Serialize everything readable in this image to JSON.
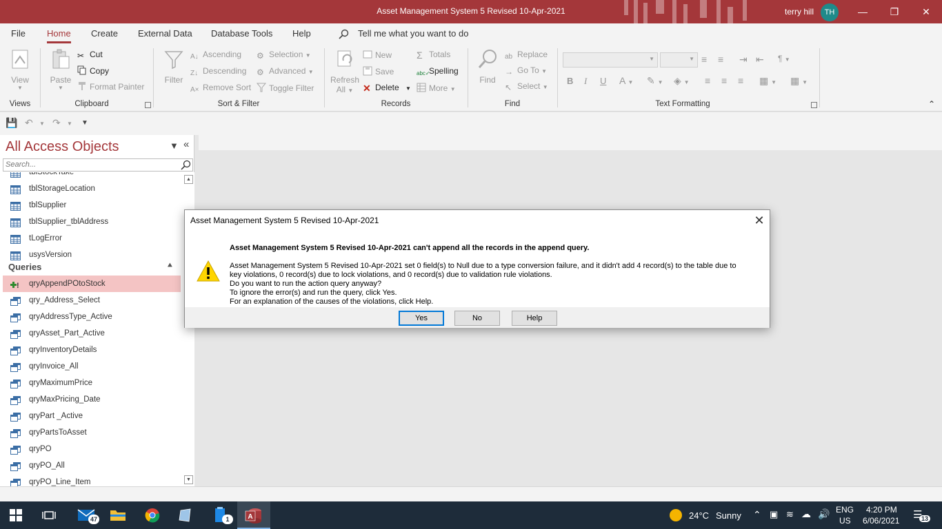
{
  "window": {
    "title": "Asset Management System 5 Revised 10-Apr-2021",
    "user_name": "terry hill",
    "user_initials": "TH",
    "minimize_icon": "minimize-icon",
    "restore_icon": "restore-icon",
    "close_icon": "close-icon"
  },
  "menu": {
    "tabs": [
      "File",
      "Home",
      "Create",
      "External Data",
      "Database Tools",
      "Help"
    ],
    "active_tab": "Home",
    "tell_me": "Tell me what you want to do"
  },
  "ribbon": {
    "views": {
      "label": "Views",
      "view": "View"
    },
    "clipboard": {
      "label": "Clipboard",
      "paste": "Paste",
      "cut": "Cut",
      "copy": "Copy",
      "format_painter": "Format Painter"
    },
    "sort_filter": {
      "label": "Sort & Filter",
      "filter": "Filter",
      "ascending": "Ascending",
      "descending": "Descending",
      "remove_sort": "Remove Sort",
      "selection": "Selection",
      "advanced": "Advanced",
      "toggle_filter": "Toggle Filter"
    },
    "records": {
      "label": "Records",
      "refresh": "Refresh",
      "refresh_all": "All",
      "new": "New",
      "save": "Save",
      "delete": "Delete",
      "totals": "Totals",
      "spelling": "Spelling",
      "more": "More"
    },
    "find": {
      "label": "Find",
      "find": "Find",
      "replace": "Replace",
      "goto": "Go To",
      "select": "Select"
    },
    "text_formatting": {
      "label": "Text Formatting",
      "bold": "B",
      "italic": "I",
      "underline": "U"
    }
  },
  "nav": {
    "title": "All Access Objects",
    "search_placeholder": "Search...",
    "tables_partial": "tblStockTake",
    "tables": [
      "tblStorageLocation",
      "tblSupplier",
      "tblSupplier_tblAddress",
      "tLogError",
      "usysVersion"
    ],
    "queries_header": "Queries",
    "selected_query": "qryAppendPOtoStock",
    "queries": [
      "qry_Address_Select",
      "qryAddressType_Active",
      "qryAsset_Part_Active",
      "qryInventoryDetails",
      "qryInvoice_All",
      "qryMaximumPrice",
      "qryMaxPricing_Date",
      "qryPart _Active",
      "qryPartsToAsset",
      "qryPO",
      "qryPO_All",
      "qryPO_Line_Item"
    ]
  },
  "dialog": {
    "title": "Asset Management System 5 Revised 10-Apr-2021",
    "main": "Asset Management System 5 Revised 10-Apr-2021 can't append all the records in the append query.",
    "lines": [
      "Asset Management System 5 Revised 10-Apr-2021 set 0 field(s) to Null due to a type conversion failure, and it didn't add 4 record(s) to the table due to",
      "key violations, 0 record(s) due to lock violations, and 0 record(s) due to validation rule violations.",
      "Do you want to run the action query anyway?",
      "To ignore the error(s) and run the query, click Yes.",
      "For an explanation of the causes of the violations, click Help."
    ],
    "yes": "Yes",
    "no": "No",
    "help": "Help",
    "icon": "warning-icon"
  },
  "taskbar": {
    "mail_badge": "47",
    "notepad_badge": "1",
    "weather_temp": "24°C",
    "weather_desc": "Sunny",
    "lang": "ENG",
    "region": "US",
    "time": "4:20 PM",
    "date": "6/06/2021",
    "notification_count": "13"
  },
  "colors": {
    "accent": "#a4373a",
    "selection": "#f4c4c4",
    "taskbar": "#1e2c3a",
    "dialog_default_border": "#0078d7"
  }
}
